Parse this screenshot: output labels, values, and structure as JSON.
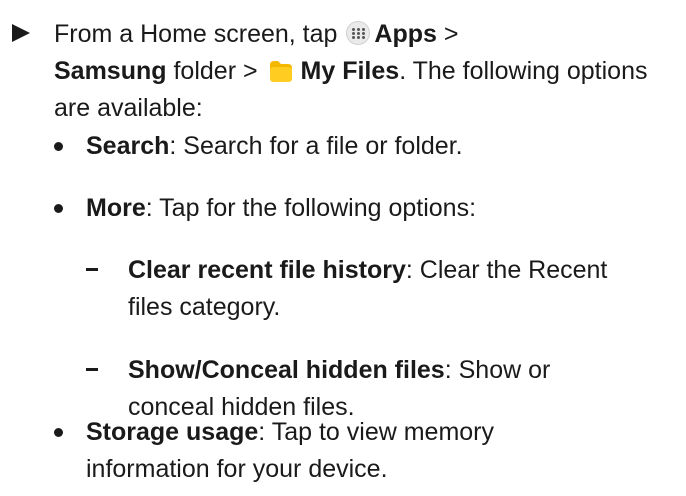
{
  "step": {
    "part1": "From a Home screen, tap",
    "apps_label": "Apps",
    "sep1": ">",
    "samsung_label": "Samsung",
    "part2": "folder >",
    "myfiles_label": "My Files",
    "part3": ". The following options are available:"
  },
  "options": [
    {
      "title": "Search",
      "desc": ": Search for a file or folder."
    },
    {
      "title": "More",
      "desc": ": Tap for the following options:"
    },
    {
      "title": "Storage usage",
      "desc": ": Tap to view memory information for your device."
    }
  ],
  "more_options": [
    {
      "title": "Clear recent file history",
      "desc": ": Clear the Recent files category."
    },
    {
      "title": "Show/Conceal hidden files",
      "desc": ": Show or conceal hidden files."
    }
  ],
  "icons": {
    "step_marker": "play-arrow-icon",
    "apps": "apps-grid-icon",
    "my_files": "folder-icon",
    "folder_color": "#f5b800"
  }
}
